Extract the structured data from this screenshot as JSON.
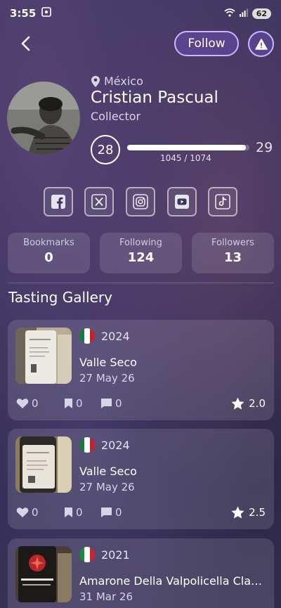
{
  "status_bar": {
    "time": "3:55",
    "battery": "62"
  },
  "header": {
    "follow_label": "Follow"
  },
  "profile": {
    "location": "México",
    "name": "Cristian Pascual",
    "rank": "Collector",
    "level": "28",
    "next_level": "29",
    "progress_text": "1045 / 1074",
    "progress_value": 1045,
    "progress_max": 1074
  },
  "socials": [
    {
      "icon": "facebook-icon"
    },
    {
      "icon": "x-icon"
    },
    {
      "icon": "instagram-icon"
    },
    {
      "icon": "youtube-icon"
    },
    {
      "icon": "tiktok-icon"
    }
  ],
  "stats": [
    {
      "label": "Bookmarks",
      "value": "0"
    },
    {
      "label": "Following",
      "value": "124"
    },
    {
      "label": "Followers",
      "value": "13"
    }
  ],
  "gallery": {
    "title": "Tasting Gallery",
    "cards": [
      {
        "vintage": "2024",
        "name": "Valle Seco",
        "date": "27 May 26",
        "likes": "0",
        "bookmarks": "0",
        "comments": "0",
        "rating": "2.0",
        "flag": [
          "#1a7a3e",
          "#ffffff",
          "#c8202e"
        ]
      },
      {
        "vintage": "2024",
        "name": "Valle Seco",
        "date": "27 May 26",
        "likes": "0",
        "bookmarks": "0",
        "comments": "0",
        "rating": "2.5",
        "flag": [
          "#1a7a3e",
          "#ffffff",
          "#c8202e"
        ]
      },
      {
        "vintage": "2021",
        "name": "Amarone Della Valpolicella Clas...",
        "date": "31 Mar 26",
        "likes": "",
        "bookmarks": "",
        "comments": "",
        "rating": "",
        "flag": [
          "#1a8a3e",
          "#ffffff",
          "#d02030"
        ]
      }
    ]
  },
  "colors": {
    "accent": "#c9b8ff",
    "button_bg": "#6e50be"
  }
}
